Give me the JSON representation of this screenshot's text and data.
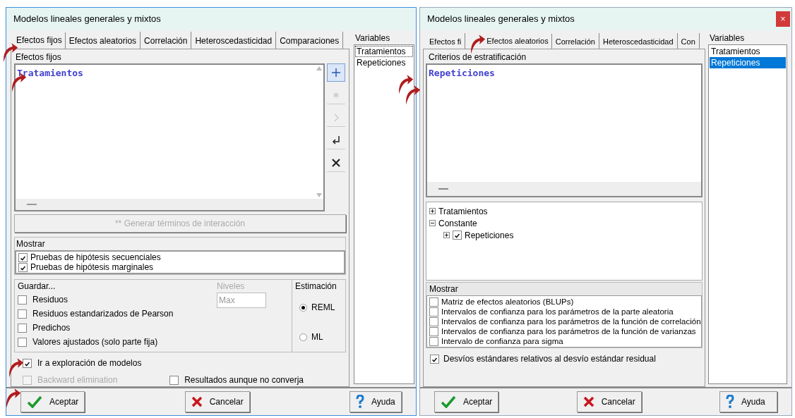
{
  "left_dialog": {
    "title": "Modelos lineales generales y mixtos",
    "tabs": [
      {
        "label": "Efectos fijos",
        "selected": true
      },
      {
        "label": "Efectos aleatorios",
        "selected": false
      },
      {
        "label": "Correlación",
        "selected": false
      },
      {
        "label": "Heteroscedasticidad",
        "selected": false
      },
      {
        "label": "Comparaciones",
        "selected": false
      }
    ],
    "effects_group": {
      "label": "Efectos fijos",
      "terms": [
        "Tratamientos"
      ]
    },
    "tools": [
      {
        "kind": "plus",
        "disabled": false,
        "highlighted": true
      },
      {
        "kind": "star",
        "disabled": true,
        "highlighted": false
      },
      {
        "kind": "chevron",
        "disabled": true,
        "highlighted": false
      },
      {
        "kind": "enter",
        "disabled": false,
        "highlighted": false
      },
      {
        "kind": "cross",
        "disabled": false,
        "highlighted": false
      }
    ],
    "interaction_button": {
      "label": "** Generar términos de interacción",
      "disabled": true
    },
    "show_group": {
      "label": "Mostrar",
      "options": [
        {
          "label": "Pruebas de hipótesis secuenciales",
          "checked": true
        },
        {
          "label": "Pruebas de hipótesis marginales",
          "checked": true
        }
      ]
    },
    "save_group": {
      "label": "Guardar...",
      "options": [
        {
          "label": "Residuos",
          "checked": false
        },
        {
          "label": "Residuos estandarizados de Pearson",
          "checked": false
        },
        {
          "label": "Predichos",
          "checked": false
        },
        {
          "label": "Valores ajustados (solo parte fija)",
          "checked": false
        }
      ],
      "levels_label": "Niveles",
      "levels_value": "Max"
    },
    "estimation_group": {
      "label": "Estimación",
      "options": [
        {
          "label": "REML",
          "selected": true
        },
        {
          "label": "ML",
          "selected": false
        }
      ]
    },
    "extra_options": [
      {
        "label": "Ir a exploración de modelos",
        "checked": true,
        "disabled": false
      },
      {
        "label": "Backward elimination",
        "checked": false,
        "disabled": true
      },
      {
        "label": "Resultados aunque no converja",
        "checked": false,
        "disabled": false
      }
    ],
    "variables": {
      "label": "Variables",
      "items": [
        {
          "label": "Tratamientos",
          "selected": false,
          "focused": true
        },
        {
          "label": "Repeticiones",
          "selected": false,
          "focused": false
        }
      ]
    },
    "buttons": [
      {
        "kind": "ok",
        "label": "Aceptar"
      },
      {
        "kind": "cancel",
        "label": "Cancelar"
      },
      {
        "kind": "help",
        "label": "Ayuda"
      }
    ]
  },
  "right_dialog": {
    "title": "Modelos lineales generales y mixtos",
    "close_label": "×",
    "tabs": [
      {
        "label": "Efectos fi",
        "selected": false
      },
      {
        "label": "Efectos aleatorios",
        "selected": true
      },
      {
        "label": "Correlación",
        "selected": false
      },
      {
        "label": "Heteroscedasticidad",
        "selected": false
      },
      {
        "label": "Con",
        "selected": false
      }
    ],
    "strata_group": {
      "label": "Criterios de estratificación",
      "terms": [
        "Repeticiones"
      ]
    },
    "tree": [
      {
        "label": "Tratamientos",
        "expanded": false
      },
      {
        "label": "Constante",
        "expanded": true,
        "children": [
          {
            "label": "Repeticiones",
            "expanded": false,
            "checked": true
          }
        ]
      }
    ],
    "show_group": {
      "label": "Mostrar",
      "options": [
        {
          "label": "Matriz de efectos aleatorios (BLUPs)",
          "checked": false
        },
        {
          "label": "Intervalos de confianza para los parámetros de la parte aleatoria",
          "checked": false
        },
        {
          "label": "Intervalos de confianza para los parámetros de la función de correlación",
          "checked": false
        },
        {
          "label": "Intervalos de confianza para los parámetros de la función de varianzas",
          "checked": false
        },
        {
          "label": "Intervalo de confianza para sigma",
          "checked": false
        }
      ]
    },
    "relative_option": {
      "label": "Desvíos estándares relativos al desvío estándar residual",
      "checked": true
    },
    "variables": {
      "label": "Variables",
      "items": [
        {
          "label": "Tratamientos",
          "selected": false,
          "focused": false
        },
        {
          "label": "Repeticiones",
          "selected": true,
          "focused": false
        }
      ]
    },
    "buttons": [
      {
        "kind": "ok",
        "label": "Aceptar"
      },
      {
        "kind": "cancel",
        "label": "Cancelar"
      },
      {
        "kind": "help",
        "label": "Ayuda"
      }
    ]
  }
}
